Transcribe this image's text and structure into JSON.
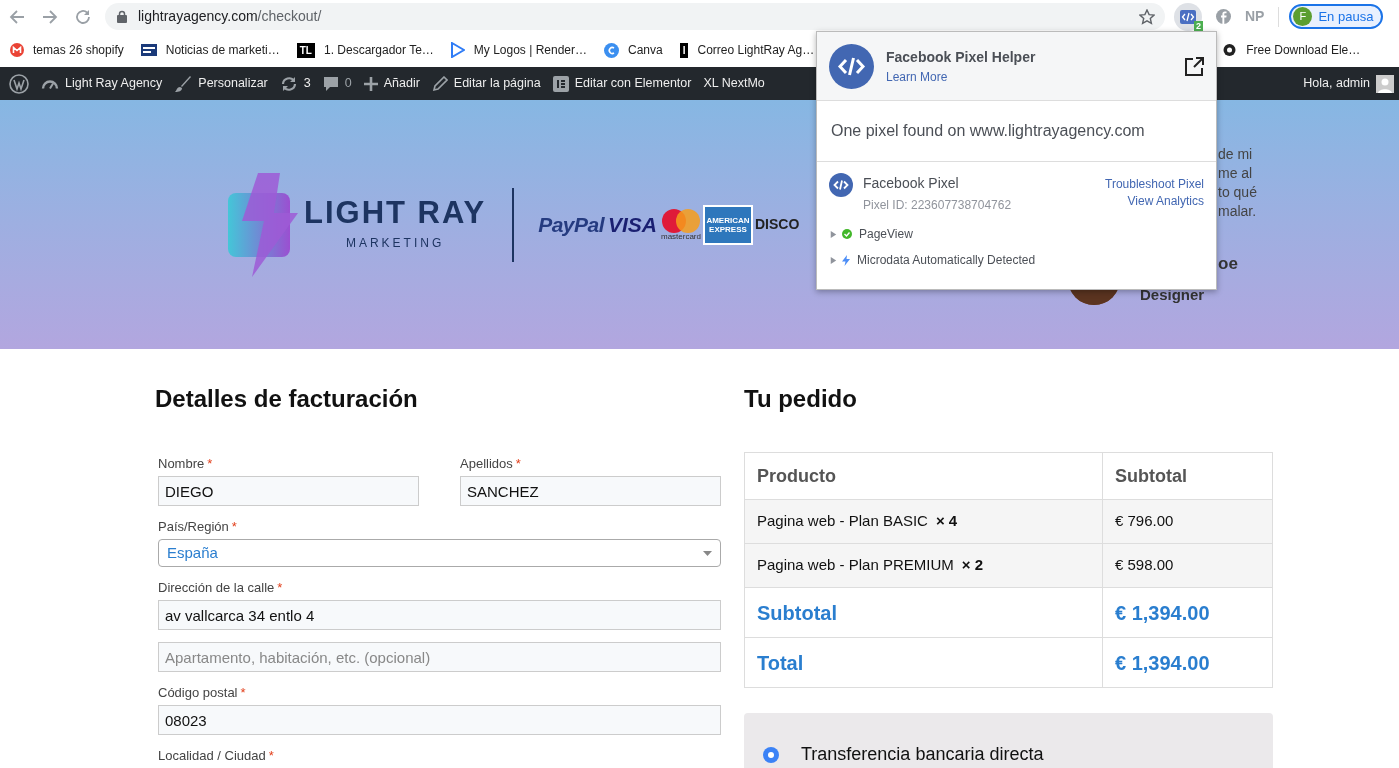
{
  "browser": {
    "url_host": "lightrayagency.com",
    "url_path": "/checkout/",
    "extension_badge": "2",
    "extension_text": "NP",
    "profile": {
      "initial": "F",
      "label": "En pausa"
    }
  },
  "bookmarks": [
    {
      "kind": "gmail",
      "label": "temas 26 shopify"
    },
    {
      "kind": "news",
      "label": "Noticias de marketi…"
    },
    {
      "kind": "letters",
      "icon_text": "TL",
      "label": "1. Descargador Te…"
    },
    {
      "kind": "play",
      "label": "My Logos | Render…"
    },
    {
      "kind": "canva",
      "label": "Canva"
    },
    {
      "kind": "letters",
      "icon_text": "I",
      "label": "Correo LightRay Ag…"
    },
    {
      "kind": "ghost",
      "label": "Free Download Ele…"
    }
  ],
  "admin_bar": {
    "items": [
      {
        "kind": "wp"
      },
      {
        "kind": "dashboard",
        "label": "Light Ray Agency"
      },
      {
        "kind": "brush",
        "label": "Personalizar"
      },
      {
        "kind": "sync",
        "label": "3"
      },
      {
        "kind": "comment",
        "label": "0"
      },
      {
        "kind": "plus",
        "label": "Añadir"
      },
      {
        "kind": "pencil",
        "label": "Editar la página"
      },
      {
        "kind": "elementor",
        "label": "Editar con Elementor"
      },
      {
        "kind": "text",
        "label": "XL NextMo"
      }
    ],
    "greeting": "Hola, admin"
  },
  "hero": {
    "logo": {
      "title": "LIGHT RAY",
      "subtitle": "MARKETING"
    },
    "payment_logos": [
      {
        "kind": "paypal",
        "label": "PayPal"
      },
      {
        "kind": "visa",
        "label": "VISA"
      },
      {
        "kind": "mastercard",
        "label": "mastercard"
      },
      {
        "kind": "amex",
        "label": "AMERICAN EXPRESS"
      },
      {
        "kind": "discover",
        "label": "DISCO"
      }
    ],
    "testimonial": {
      "lines": [
        "de mi",
        "me al",
        "to qué",
        "malar."
      ],
      "name": "oe",
      "role": "Designer"
    }
  },
  "popup": {
    "title": "Facebook Pixel Helper",
    "learn_more": "Learn More",
    "summary": "One pixel found on www.lightrayagency.com",
    "pixel": {
      "name": "Facebook Pixel",
      "id": "Pixel ID: 223607738704762",
      "links": [
        "Troubleshoot Pixel",
        "View Analytics"
      ]
    },
    "events": [
      {
        "kind": "success",
        "label": "PageView",
        "expanded": false
      },
      {
        "kind": "auto",
        "label": "Microdata Automatically Detected",
        "expanded": false
      }
    ]
  },
  "billing": {
    "heading": "Detalles de facturación",
    "rows": [
      [
        {
          "kind": "text",
          "label": "Nombre",
          "required_mark": "*",
          "value": "DIEGO"
        },
        {
          "kind": "text",
          "label": "Apellidos",
          "required_mark": "*",
          "value": "SANCHEZ"
        }
      ],
      [
        {
          "kind": "select",
          "label": "País/Región",
          "required_mark": "*",
          "value": "España"
        }
      ],
      [
        {
          "kind": "text",
          "label": "Dirección de la calle",
          "required_mark": "*",
          "value": "av vallcarca 34 entlo 4"
        }
      ],
      [
        {
          "kind": "text",
          "placeholder": "Apartamento, habitación, etc. (opcional)"
        }
      ],
      [
        {
          "kind": "text",
          "label": "Código postal",
          "required_mark": "*",
          "value": "08023"
        }
      ],
      [
        {
          "kind": "label",
          "label": "Localidad / Ciudad",
          "required_mark": "*"
        }
      ]
    ]
  },
  "order": {
    "heading": "Tu pedido",
    "columns": [
      "Producto",
      "Subtotal"
    ],
    "items": [
      {
        "name": "Pagina web - Plan BASIC",
        "qty": "× 4",
        "subtotal": "€ 796.00"
      },
      {
        "name": "Pagina web - Plan PREMIUM",
        "qty": "× 2",
        "subtotal": "€ 598.00"
      }
    ],
    "totals": [
      {
        "label": "Subtotal",
        "value": "€ 1,394.00"
      },
      {
        "label": "Total",
        "value": "€ 1,394.00"
      }
    ]
  },
  "payment_methods": [
    {
      "label": "Transferencia bancaria directa",
      "selected": true
    }
  ]
}
